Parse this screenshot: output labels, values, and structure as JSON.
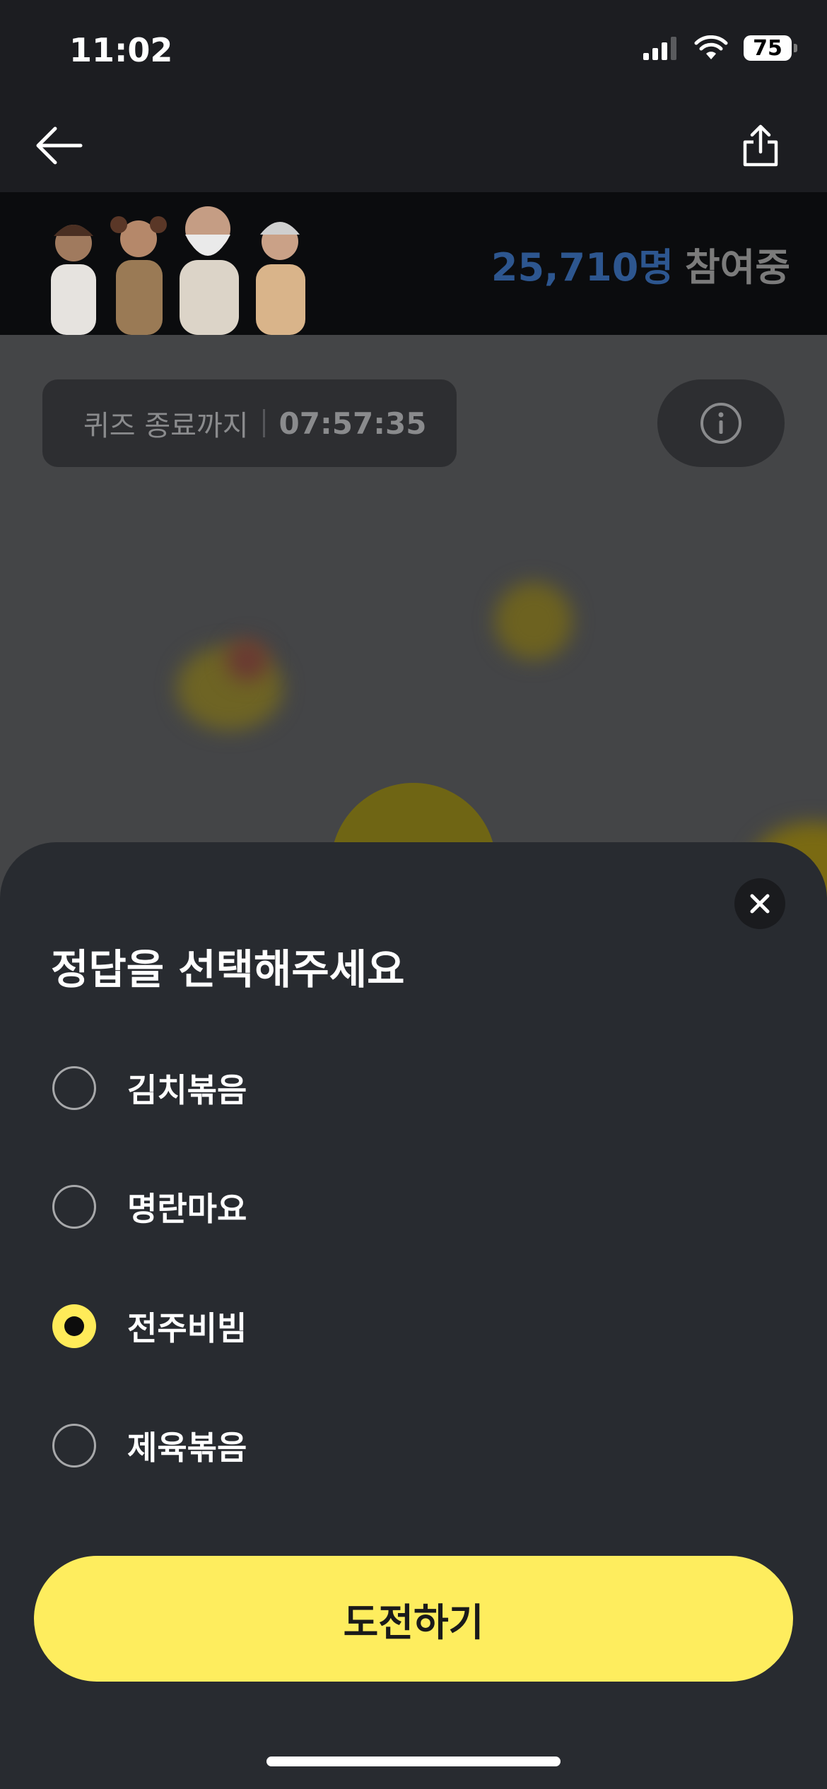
{
  "status_bar": {
    "time": "11:02",
    "battery": "75"
  },
  "header": {
    "back_icon": "arrow-left-icon",
    "share_icon": "share-icon"
  },
  "banner": {
    "participant_count": "25,710명",
    "participant_suffix": "참여중"
  },
  "quiz": {
    "timer_label": "퀴즈 종료까지",
    "timer_value": "07:57:35",
    "info_icon": "info-icon"
  },
  "sheet": {
    "title": "정답을 선택해주세요",
    "options": [
      {
        "label": "김치볶음",
        "selected": false
      },
      {
        "label": "명란마요",
        "selected": false
      },
      {
        "label": "전주비빔",
        "selected": true
      },
      {
        "label": "제육볶음",
        "selected": false
      }
    ],
    "submit_label": "도전하기"
  },
  "colors": {
    "accent_yellow": "#ffeb59",
    "count_blue": "#2d568f",
    "sheet_bg": "#282b30"
  }
}
